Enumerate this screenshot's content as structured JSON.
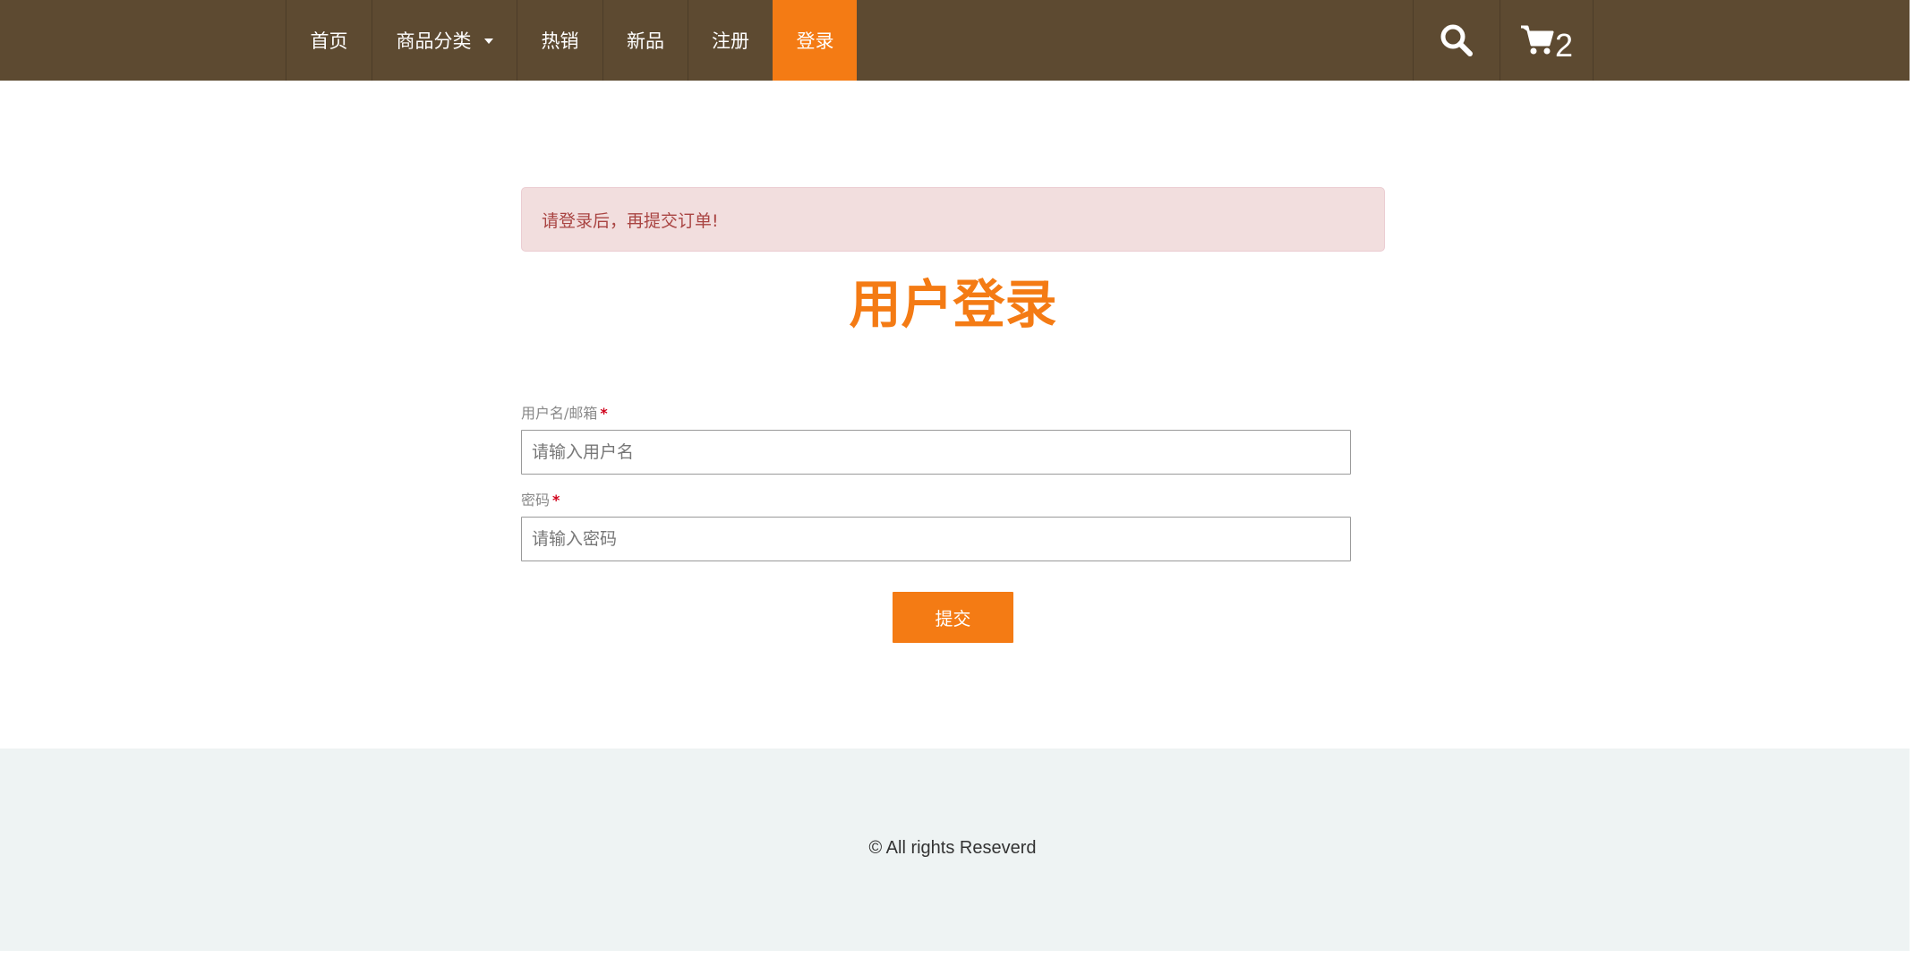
{
  "nav": {
    "items": [
      {
        "label": "首页"
      },
      {
        "label": "商品分类"
      },
      {
        "label": "热销"
      },
      {
        "label": "新品"
      },
      {
        "label": "注册"
      },
      {
        "label": "登录",
        "active": true
      }
    ],
    "cart_count": "2",
    "icons": [
      "search-icon",
      "cart-icon",
      "chevron-down-icon"
    ],
    "colors": {
      "bar": "#5d4a31",
      "active": "#f47b14"
    }
  },
  "alert": {
    "text": "请登录后，再提交订单!"
  },
  "login": {
    "title": "用户登录",
    "username_label": "用户名/邮箱",
    "username_placeholder": "请输入用户名",
    "password_label": "密码",
    "password_placeholder": "请输入密码",
    "required_mark": "*",
    "submit_label": "提交"
  },
  "footer": {
    "copyright": "© All rights Reseverd"
  }
}
